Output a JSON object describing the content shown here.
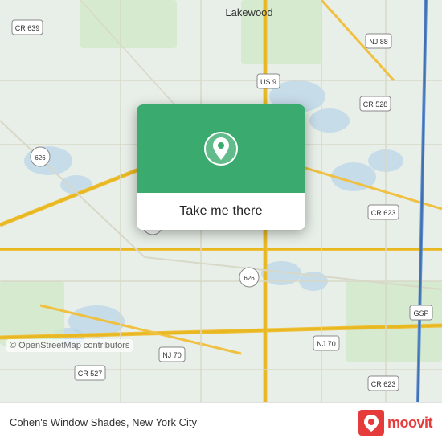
{
  "map": {
    "copyright": "© OpenStreetMap contributors",
    "background_color": "#e8efe8"
  },
  "popup": {
    "button_label": "Take me there",
    "pin_color": "#ffffff",
    "bg_color": "#3aaa6e"
  },
  "bottom_bar": {
    "location_text": "Cohen's Window Shades, New York City"
  },
  "moovit": {
    "label": "moovit"
  },
  "road_labels": [
    "Lakewood",
    "NJ 88",
    "US 9",
    "CR 528",
    "CR 639",
    "626",
    "626",
    "626",
    "CR 623",
    "NJ 70",
    "NJ 70",
    "CR 527",
    "CR 623",
    "GSP"
  ]
}
